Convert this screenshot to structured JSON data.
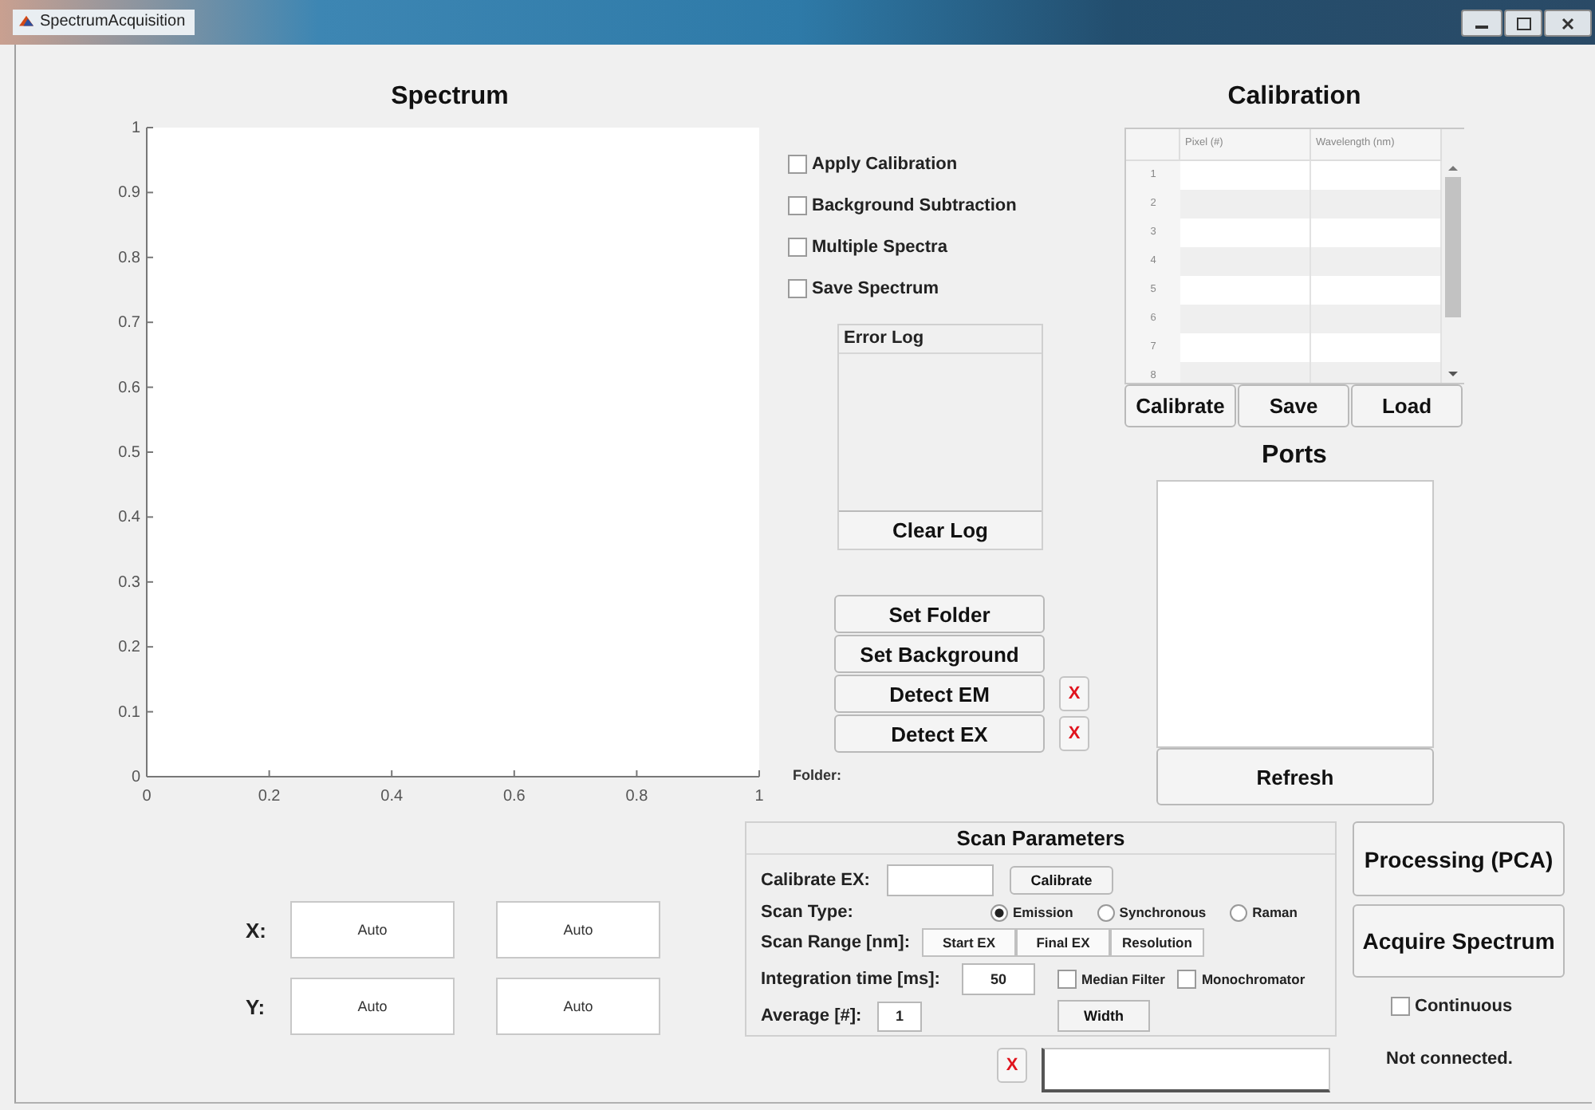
{
  "window": {
    "title": "SpectrumAcquisition"
  },
  "spectrum": {
    "title": "Spectrum",
    "chart_data": {
      "type": "line",
      "xlim": [
        0,
        1
      ],
      "ylim": [
        0,
        1
      ],
      "xticks": [
        0,
        0.2,
        0.4,
        0.6,
        0.8,
        1
      ],
      "yticks": [
        0,
        0.1,
        0.2,
        0.3,
        0.4,
        0.5,
        0.6,
        0.7,
        0.8,
        0.9,
        1
      ]
    }
  },
  "axis_limits": [
    {
      "label": "X:",
      "min": "Auto",
      "max": "Auto"
    },
    {
      "label": "Y:",
      "min": "Auto",
      "max": "Auto"
    }
  ],
  "options": [
    {
      "label": "Apply Calibration",
      "checked": false
    },
    {
      "label": "Background Subtraction",
      "checked": false
    },
    {
      "label": "Multiple Spectra",
      "checked": false
    },
    {
      "label": "Save Spectrum",
      "checked": false
    }
  ],
  "error_log": {
    "title": "Error Log",
    "button": "Clear Log"
  },
  "actions": [
    {
      "label": "Set Folder"
    },
    {
      "label": "Set Background"
    },
    {
      "label": "Detect EM",
      "clear": "X"
    },
    {
      "label": "Detect EX",
      "clear": "X"
    }
  ],
  "folder_label": "Folder:",
  "calibration": {
    "title": "Calibration",
    "columns": [
      "Pixel (#)",
      "Wavelength (nm)"
    ],
    "rows": [
      "1",
      "2",
      "3",
      "4",
      "5",
      "6",
      "7",
      "8"
    ],
    "buttons": [
      "Calibrate",
      "Save",
      "Load"
    ]
  },
  "ports": {
    "title": "Ports",
    "button": "Refresh"
  },
  "scan_parameters": {
    "title": "Scan Parameters",
    "calibrate_ex": {
      "label": "Calibrate EX:",
      "button": "Calibrate"
    },
    "scan_type": {
      "label": "Scan Type:",
      "options": [
        {
          "label": "Emission",
          "selected": true
        },
        {
          "label": "Synchronous",
          "selected": false
        },
        {
          "label": "Raman",
          "selected": false
        }
      ]
    },
    "scan_range": {
      "label": "Scan Range [nm]:",
      "buttons": [
        "Start EX",
        "Final EX",
        "Resolution"
      ]
    },
    "integration": {
      "label": "Integration time [ms]:",
      "value": "50"
    },
    "average": {
      "label": "Average [#]:",
      "value": "1"
    },
    "filters": [
      {
        "label": "Median Filter",
        "checked": false
      },
      {
        "label": "Monochromator",
        "checked": false
      }
    ],
    "width_button": "Width"
  },
  "side_buttons": [
    "Processing (PCA)",
    "Acquire Spectrum"
  ],
  "continuous": {
    "label": "Continuous",
    "checked": false
  },
  "command": {
    "clear": "X"
  },
  "status": "Not connected."
}
